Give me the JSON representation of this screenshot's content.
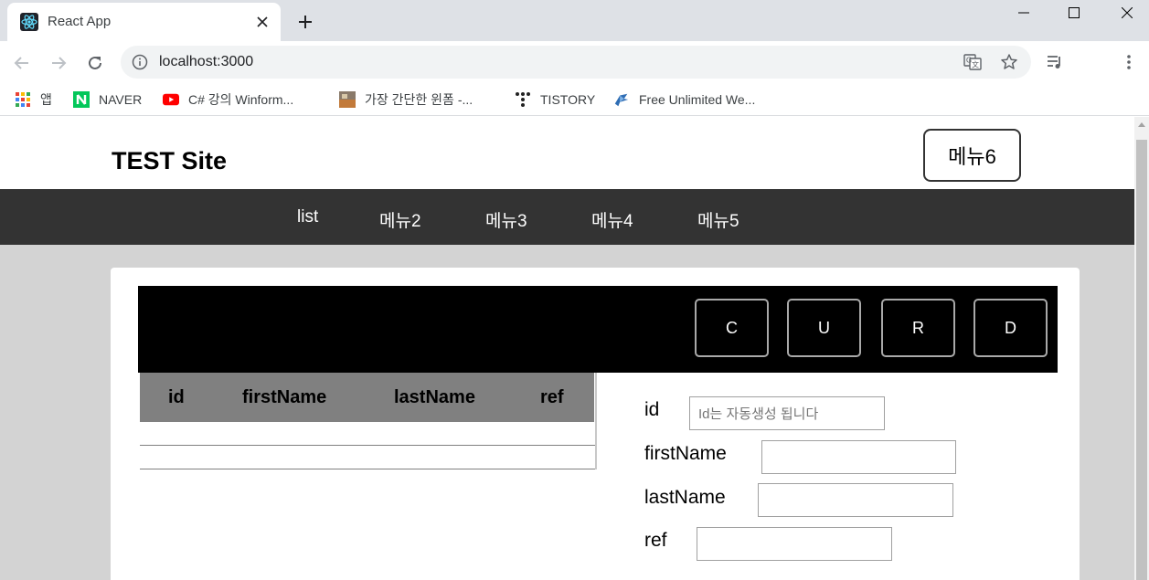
{
  "browser": {
    "tab_title": "React App",
    "url": "localhost:3000",
    "bookmarks": [
      {
        "label": "앱",
        "icon": "apps-grid-icon"
      },
      {
        "label": "NAVER",
        "icon": "naver-icon"
      },
      {
        "label": "C# 강의 Winform...",
        "icon": "youtube-icon"
      },
      {
        "label": "가장 간단한 윈폼 -...",
        "icon": "image-favicon-icon"
      },
      {
        "label": "TISTORY",
        "icon": "tistory-icon"
      },
      {
        "label": "Free Unlimited We...",
        "icon": "bird-icon"
      }
    ]
  },
  "site": {
    "title": "TEST Site",
    "menu6_label": "메뉴6",
    "nav": [
      "list",
      "메뉴2",
      "메뉴3",
      "메뉴4",
      "메뉴5"
    ]
  },
  "crud": {
    "buttons": [
      "C",
      "U",
      "R",
      "D"
    ]
  },
  "table": {
    "columns": [
      "id",
      "firstName",
      "lastName",
      "ref"
    ],
    "rows": []
  },
  "form": {
    "id_label": "id",
    "id_placeholder": "Id는 자동생성 됩니다",
    "firstName_label": "firstName",
    "firstName_value": "",
    "lastName_label": "lastName",
    "lastName_value": "",
    "ref_label": "ref",
    "ref_value": ""
  },
  "colors": {
    "nav_bg": "#333333",
    "page_bg": "#d3d3d3",
    "crud_bar_bg": "#000000",
    "table_header_bg": "#808080"
  }
}
